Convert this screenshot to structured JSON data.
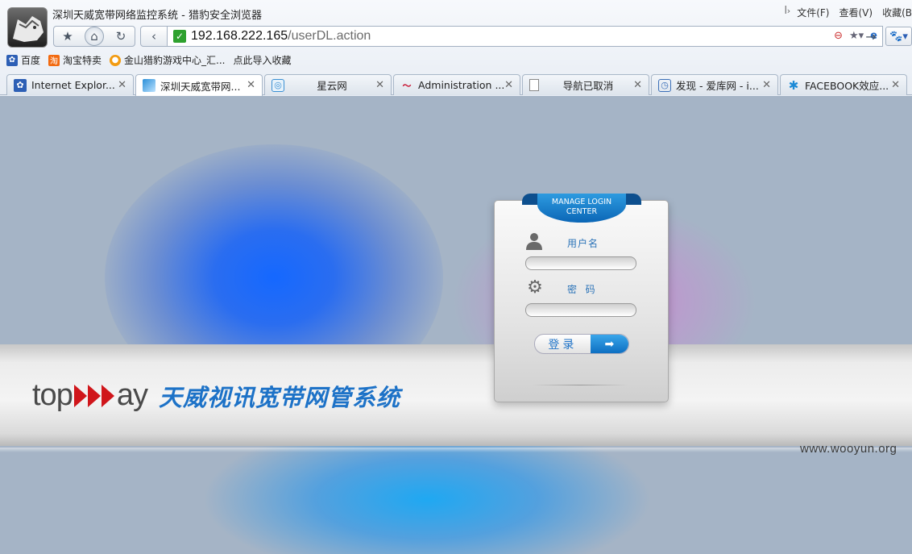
{
  "window": {
    "title": "深圳天威宽带网络监控系统 - 猎豹安全浏览器",
    "menus": [
      "文件(F)",
      "查看(V)",
      "收藏(B"
    ]
  },
  "address_bar": {
    "url_host": "192.168.222.165",
    "url_path": "/userDL.action"
  },
  "bookmarks": [
    {
      "label": "百度",
      "icon": "baidu-paw-icon",
      "color": "#2d5fb5"
    },
    {
      "label": "淘宝特卖",
      "icon": "taobao-icon",
      "color": "#f26a10"
    },
    {
      "label": "金山猎豹游戏中心_汇...",
      "icon": "kingsoft-game-icon",
      "color": "#f29b11"
    },
    {
      "label": "点此导入收藏",
      "icon": "",
      "color": ""
    }
  ],
  "tabs": [
    {
      "label": "Internet Explor...",
      "icon": "baidu-paw-icon",
      "active": false
    },
    {
      "label": "深圳天威宽带网...",
      "icon": "topway-icon",
      "active": true
    },
    {
      "label": "星云网",
      "icon": "xingyun-icon",
      "active": false
    },
    {
      "label": "Administration ...",
      "icon": "admin-swoosh-icon",
      "active": false
    },
    {
      "label": "导航已取消",
      "icon": "blank-page-icon",
      "active": false
    },
    {
      "label": "发现 - 爱库网 - i...",
      "icon": "aiku-icon",
      "active": false
    },
    {
      "label": "FACEBOOK效应...",
      "icon": "facebook-star-icon",
      "active": false
    }
  ],
  "page": {
    "brand_text_left": "top",
    "brand_text_right": "ay",
    "brand_cn": "天威视讯宽带网管系统",
    "ribbon_line1": "MANAGE LOGIN",
    "ribbon_line2": "CENTER",
    "username_label": "用户名",
    "password_label": "密  码",
    "login_label": "登录",
    "username_value": "",
    "password_value": ""
  },
  "watermark": "www.wooyun.org",
  "colors": {
    "accent_blue": "#1d72c7",
    "arrow_red": "#d0161b",
    "ribbon_blue": "#0b66b6"
  }
}
